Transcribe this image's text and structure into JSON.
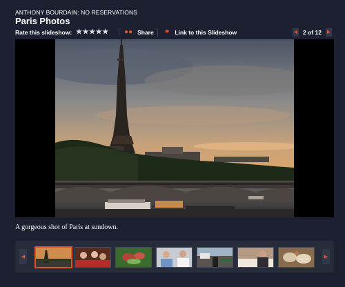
{
  "header": {
    "show_name": "ANTHONY BOURDAIN: NO RESERVATIONS",
    "gallery_title": "Paris Photos"
  },
  "toolbar": {
    "rate_label": "Rate this slideshow:",
    "stars": "★★★★★",
    "rating_max": 5,
    "share_label": "Share",
    "share_icon": "people-icon",
    "link_label": "Link to this Slideshow",
    "link_icon": "chain-link-icon",
    "counter": "2 of 12",
    "prev_icon": "chevron-left-icon",
    "next_icon": "chevron-right-icon"
  },
  "slide": {
    "caption": "A gorgeous shot of Paris at sundown."
  },
  "filmstrip": {
    "selected_index": 0,
    "thumbs": [
      {
        "subject": "eiffel-tower-sundown"
      },
      {
        "subject": "dining-group"
      },
      {
        "subject": "food-plate-green"
      },
      {
        "subject": "two-men-talking"
      },
      {
        "subject": "cafe-street"
      },
      {
        "subject": "diner-at-table"
      },
      {
        "subject": "food-spread"
      }
    ]
  },
  "colors": {
    "background": "#1c2030",
    "accent": "#e0542a",
    "strip": "#272c3b"
  }
}
